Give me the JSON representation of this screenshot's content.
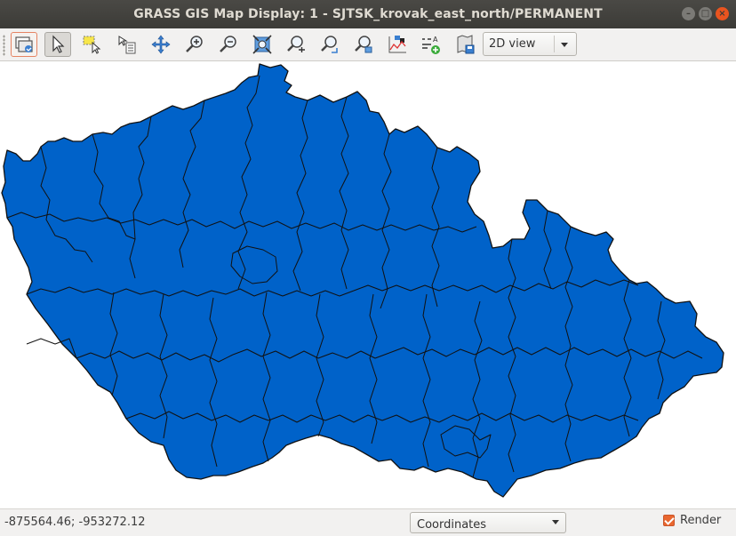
{
  "window": {
    "title": "GRASS GIS Map Display: 1 - SJTSK_krovak_east_north/PERMANENT",
    "controls": [
      "minimize-icon",
      "maximize-icon",
      "close-icon"
    ]
  },
  "toolbar": {
    "tools": [
      {
        "name": "display-map-tool",
        "icon": "display-map-icon",
        "state": "highlighted"
      },
      {
        "name": "pointer-tool",
        "icon": "pointer-icon",
        "state": "active"
      },
      {
        "name": "select-tool",
        "icon": "select-icon"
      },
      {
        "name": "query-tool",
        "icon": "query-icon"
      },
      {
        "name": "pan-tool",
        "icon": "pan-icon"
      },
      {
        "name": "zoom-in-tool",
        "icon": "zoom-in-icon"
      },
      {
        "name": "zoom-out-tool",
        "icon": "zoom-out-icon"
      },
      {
        "name": "zoom-extent-tool",
        "icon": "zoom-extent-icon"
      },
      {
        "name": "zoom-menu-tool",
        "icon": "zoom-menu-icon"
      },
      {
        "name": "zoom-back-tool",
        "icon": "zoom-back-icon"
      },
      {
        "name": "zoom-region-tool",
        "icon": "zoom-region-icon"
      },
      {
        "name": "analyze-tool",
        "icon": "analyze-icon"
      },
      {
        "name": "decoration-tool",
        "icon": "decoration-icon"
      },
      {
        "name": "save-image-tool",
        "icon": "save-image-icon"
      }
    ],
    "view_mode": "2D view"
  },
  "map": {
    "fill_color": "#0062c9",
    "border_color": "#111111"
  },
  "statusbar": {
    "coordinates": "-875564.46; -953272.12",
    "mode": "Coordinates",
    "render_label": "Render",
    "render_checked": true,
    "accent": "#e9672f"
  }
}
